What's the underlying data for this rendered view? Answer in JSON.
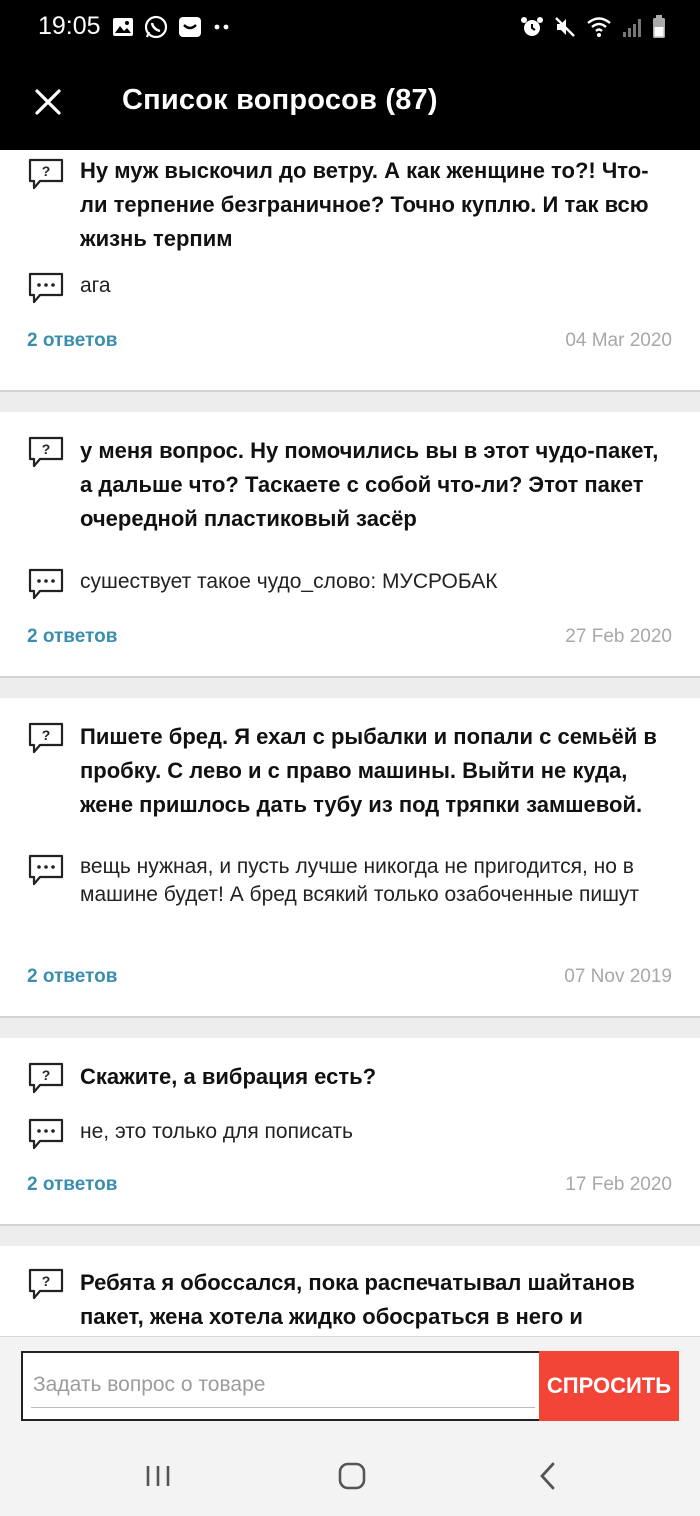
{
  "status": {
    "time": "19:05"
  },
  "appbar": {
    "title": "Список вопросов (87)"
  },
  "questions": [
    {
      "question": " Ну муж выскочил до ветру. А как женщине то?! Что-ли терпение безграничное? Точно куплю. И так всю жизнь терпим",
      "answer": "ага",
      "answers_label": "2 ответов",
      "date": "04 Mar 2020"
    },
    {
      "question": "у меня вопрос. Ну помочились вы в этот чудо-пакет, а дальше что? Таскаете с собой что-ли? Этот пакет очередной пластиковый засёр",
      "answer": "сушествует такое чудо_слово: МУСРОБАК",
      "answers_label": "2 ответов",
      "date": "27 Feb 2020"
    },
    {
      "question": "Пишете бред. Я ехал с рыбалки и попали с семьёй в пробку. С лево и с право машины. Выйти не куда, жене пришлось дать тубу из под тряпки замшевой.",
      "answer": "вещь нужная, и пусть лучше никогда не пригодится, но в машине будет! А бред всякий только озабоченные пишут",
      "answers_label": "2 ответов",
      "date": "07 Nov 2019"
    },
    {
      "question": "Скажите, а вибрация есть?",
      "answer": "не, это только для пописать",
      "answers_label": "2 ответов",
      "date": "17 Feb 2020"
    },
    {
      "question": "Ребята я обоссался, пока распечатывал шайтанов пакет, жена хотела жидко обосраться в него и",
      "answer": "",
      "answers_label": "",
      "date": ""
    }
  ],
  "ask": {
    "placeholder": "Задать вопрос о товаре",
    "button_label": "СПРОСИТЬ"
  },
  "colors": {
    "accent_link": "#3a8fb0",
    "button": "#f24538",
    "date": "#a8a8a8"
  },
  "icons": {
    "question": "question-bubble-icon",
    "answer": "answer-bubble-icon",
    "close": "close-icon"
  }
}
